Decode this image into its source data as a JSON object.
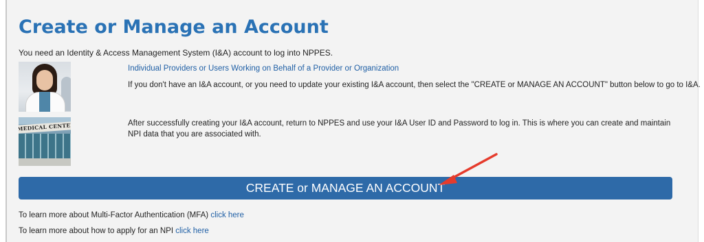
{
  "page": {
    "title": "Create or Manage an Account",
    "intro": "You need an Identity & Access Management System (I&A) account to log into NPPES."
  },
  "section": {
    "heading": "Individual Providers or Users Working on Behalf of a Provider or Organization",
    "paragraph_1": "If you don't have an I&A account, or you need to update your existing I&A account, then select the \"CREATE or MANAGE AN ACCOUNT\" button below to go to I&A.",
    "paragraph_2": "After successfully creating your I&A account, return to NPPES and use your I&A User ID and Password to log in. This is where you can create and maintain NPI data that you are associated with."
  },
  "images": {
    "provider_photo_icon": "doctor-photo",
    "building_photo_icon": "medical-center-photo",
    "building_sign": "MEDICAL CENTER"
  },
  "cta": {
    "label": "CREATE or MANAGE AN ACCOUNT"
  },
  "learn_more": {
    "mfa_text": "To learn more about Multi-Factor Authentication (MFA) ",
    "mfa_link": "click here",
    "npi_text": "To learn more about how to apply for an NPI ",
    "npi_link": "click here"
  },
  "colors": {
    "title": "#2a72b5",
    "button": "#2e6aa8",
    "link": "#1f5fa5",
    "annotation_arrow": "#e53b2c"
  }
}
